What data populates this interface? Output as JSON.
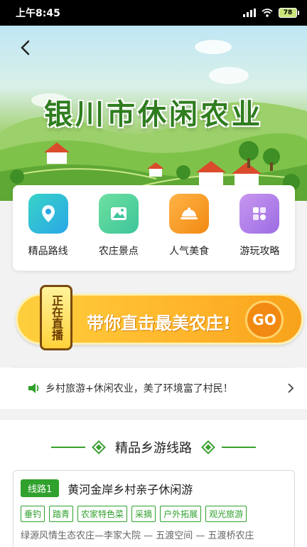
{
  "status_bar": {
    "time": "上午8:45",
    "battery": "78"
  },
  "banner": {
    "title": "银川市休闲农业"
  },
  "quick_menu": {
    "items": [
      {
        "label": "精品路线",
        "icon": "map-pin-icon",
        "color_from": "#38d3c8",
        "color_to": "#2aa7e6"
      },
      {
        "label": "农庄景点",
        "icon": "landscape-icon",
        "color_from": "#6fe0a0",
        "color_to": "#3cc59b"
      },
      {
        "label": "人气美食",
        "icon": "food-dish-icon",
        "color_from": "#ffb347",
        "color_to": "#f28a12"
      },
      {
        "label": "游玩攻略",
        "icon": "guide-icon",
        "color_from": "#c897ef",
        "color_to": "#9c6ce4"
      }
    ]
  },
  "live_banner": {
    "badge": "正在直播",
    "text": "带你直击最美农庄!",
    "go": "GO"
  },
  "notice": {
    "text": "乡村旅游+休闲农业，美了环境富了村民！"
  },
  "routes": {
    "section_title": "精品乡游线路",
    "route": {
      "badge": "线路1",
      "name": "黄河金岸乡村亲子休闲游",
      "tags": [
        "垂钓",
        "踏青",
        "农家特色菜",
        "采摘",
        "户外拓展",
        "观光旅游"
      ],
      "desc": "绿源风情生态农庄—李家大院 — 五渡空间 — 五渡桥农庄"
    }
  },
  "colors": {
    "accent_green": "#2fa12c",
    "title_green": "#2f7d1f",
    "orange": "#f28a12"
  }
}
